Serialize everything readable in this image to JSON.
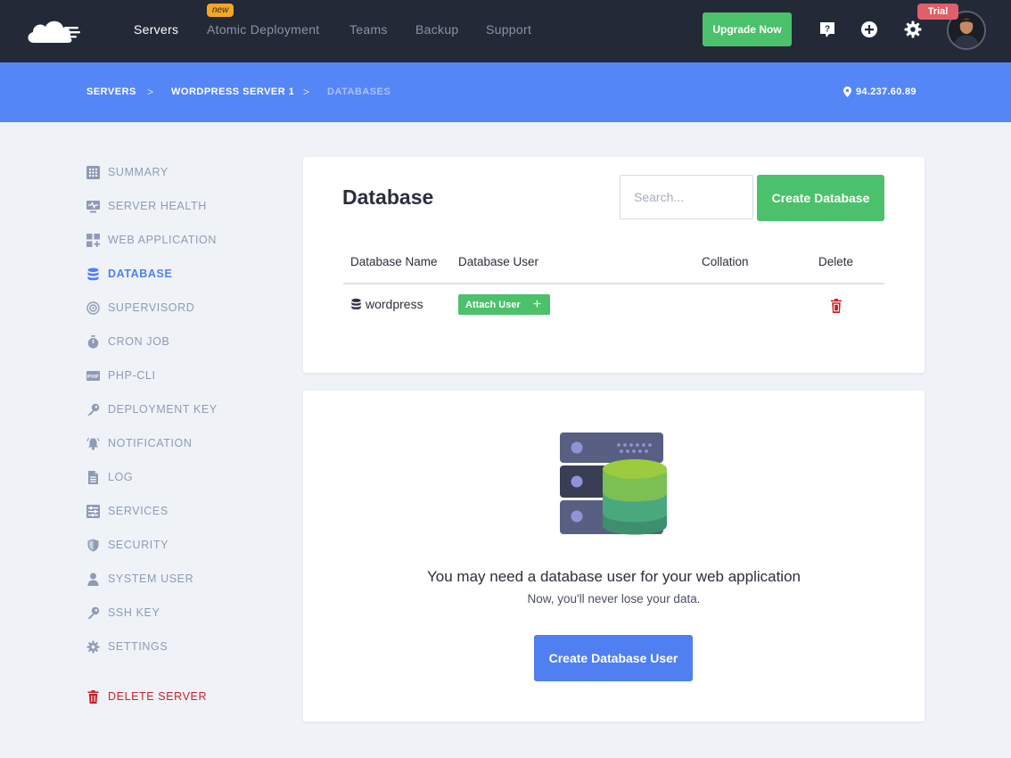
{
  "nav": {
    "items": [
      {
        "label": "Servers"
      },
      {
        "label": "Atomic Deployment"
      },
      {
        "label": "Teams"
      },
      {
        "label": "Backup"
      },
      {
        "label": "Support"
      }
    ],
    "new_badge": "new",
    "upgrade_label": "Upgrade Now",
    "trial_badge": "Trial",
    "icons": [
      "help-icon",
      "add-icon",
      "gear-icon"
    ]
  },
  "breadcrumb": {
    "items": [
      "SERVERS",
      "WORDPRESS SERVER 1",
      "DATABASES"
    ],
    "separator": ">",
    "ip": "94.237.60.89"
  },
  "sidebar": {
    "items": [
      {
        "label": "SUMMARY",
        "icon": "summary-icon"
      },
      {
        "label": "SERVER HEALTH",
        "icon": "server-health-icon"
      },
      {
        "label": "WEB APPLICATION",
        "icon": "web-application-icon"
      },
      {
        "label": "DATABASE",
        "icon": "database-icon",
        "active": true
      },
      {
        "label": "SUPERVISORD",
        "icon": "supervisord-icon"
      },
      {
        "label": "CRON JOB",
        "icon": "stopwatch-icon"
      },
      {
        "label": "PHP-CLI",
        "icon": "php-icon"
      },
      {
        "label": "DEPLOYMENT KEY",
        "icon": "key-icon"
      },
      {
        "label": "NOTIFICATION",
        "icon": "bell-icon"
      },
      {
        "label": "LOG",
        "icon": "file-icon"
      },
      {
        "label": "SERVICES",
        "icon": "services-icon"
      },
      {
        "label": "SECURITY",
        "icon": "shield-icon"
      },
      {
        "label": "SYSTEM USER",
        "icon": "user-icon"
      },
      {
        "label": "SSH KEY",
        "icon": "key-icon"
      },
      {
        "label": "SETTINGS",
        "icon": "gear-icon"
      }
    ],
    "delete_label": "DELETE SERVER"
  },
  "database_card": {
    "title": "Database",
    "search_placeholder": "Search...",
    "create_label": "Create Database",
    "columns": [
      "Database Name",
      "Database User",
      "Collation",
      "Delete"
    ],
    "rows": [
      {
        "name": "wordpress",
        "attach_label": "Attach User",
        "collation": ""
      }
    ]
  },
  "empty_state": {
    "title": "You may need a database user for your web application",
    "subtitle": "Now, you'll never lose your data.",
    "button_label": "Create Database User"
  },
  "colors": {
    "topbar": "#232937",
    "breadcrumb_bar": "#5586f6",
    "green": "#4bc16b",
    "blue": "#4f7ff0",
    "danger": "#c8202c"
  }
}
